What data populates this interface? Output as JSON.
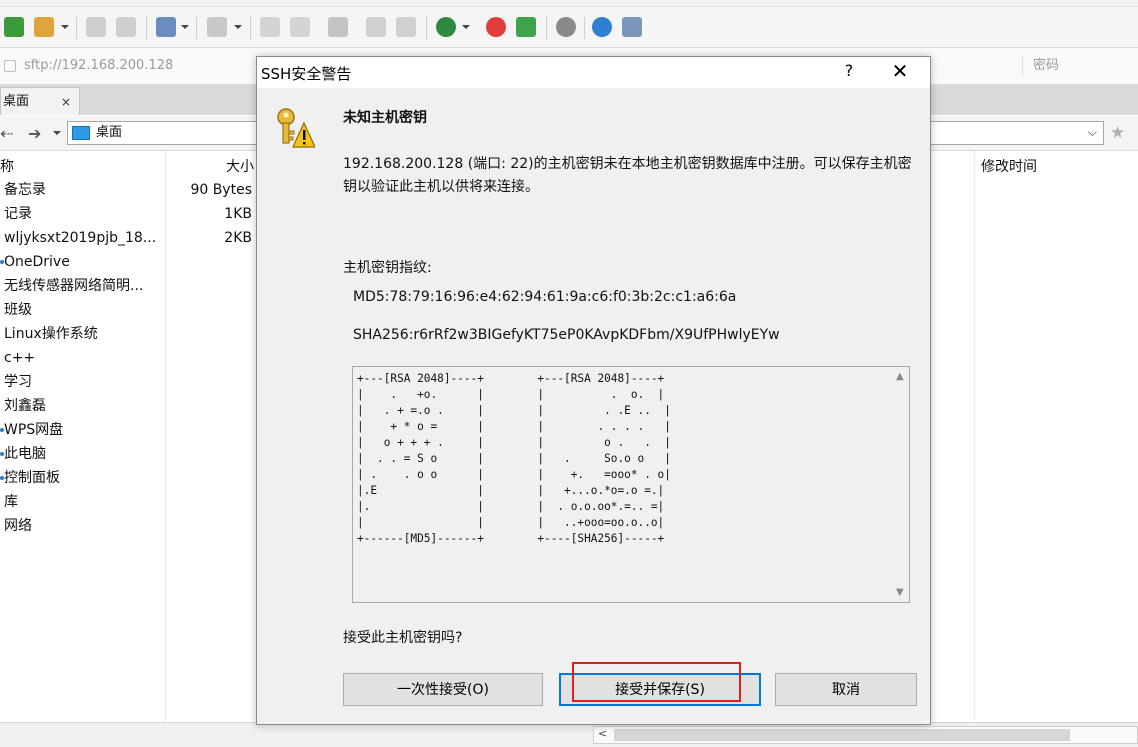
{
  "toolbar": {
    "icons": [
      "new-session-icon",
      "open-folder-icon",
      "connect-icon",
      "disconnect-icon",
      "settings-icon",
      "terminal-icon",
      "copy-icon",
      "paste-icon",
      "sync-icon",
      "queue-icon",
      "web-icon",
      "snail-icon",
      "edit-icon",
      "gear-icon",
      "help-icon",
      "chat-icon"
    ]
  },
  "address": {
    "host": "sftp://192.168.200.128",
    "password_placeholder": "密码"
  },
  "tab": {
    "label": "桌面",
    "close": "×"
  },
  "nav": {
    "path": "桌面"
  },
  "columns": {
    "name": "称",
    "size": "大小",
    "modified": "修改时间"
  },
  "files": [
    {
      "name": "备忘录",
      "size": "90 Bytes"
    },
    {
      "name": "记录",
      "size": "1KB"
    },
    {
      "name": "wljyksxt2019pjb_18...",
      "size": "2KB"
    },
    {
      "name": "OneDrive",
      "size": ""
    },
    {
      "name": "无线传感器网络简明...",
      "size": ""
    },
    {
      "name": "班级",
      "size": ""
    },
    {
      "name": "Linux操作系统",
      "size": ""
    },
    {
      "name": "c++",
      "size": ""
    },
    {
      "name": "学习",
      "size": ""
    },
    {
      "name": "刘鑫磊",
      "size": ""
    },
    {
      "name": "WPS网盘",
      "size": ""
    },
    {
      "name": "此电脑",
      "size": ""
    },
    {
      "name": "控制面板",
      "size": ""
    },
    {
      "name": "库",
      "size": ""
    },
    {
      "name": "网络",
      "size": ""
    }
  ],
  "dialog": {
    "title": "SSH安全警告",
    "help": "?",
    "close": "✕",
    "heading": "未知主机密钥",
    "message": "192.168.200.128 (端口: 22)的主机密钥未在本地主机密钥数据库中注册。可以保存主机密钥以验证此主机以供将来连接。",
    "fingerprint_label": "主机密钥指纹:",
    "md5": "MD5:78:79:16:96:e4:62:94:61:9a:c6:f0:3b:2c:c1:a6:6a",
    "sha256": "SHA256:r6rRf2w3BIGefyKT75eP0KAvpKDFbm/X9UfPHwlyEYw",
    "randomart": "+---[RSA 2048]----+        +---[RSA 2048]----+\n|    .   +o.      |        |          .  o.  |\n|   . + =.o .     |        |         . .E ..  |\n|    + * o =      |        |        . . . .   |\n|   o + + + .     |        |         o .   .  |\n|  . . = S o      |        |   .     So.o o   |\n| .    . o o      |        |    +.   =ooo* . o|\n|.E               |        |   +...o.*o=.o =.|\n|.                |        |  . o.o.oo*.=.. =|\n|                 |        |   ..+ooo=oo.o..o|\n+------[MD5]------+        +----[SHA256]-----+",
    "question": "接受此主机密钥吗?",
    "buttons": {
      "once": "一次性接受(O)",
      "save": "接受并保存(S)",
      "cancel": "取消"
    },
    "highlight_color": "#e02020",
    "default_button_color": "#0078d7"
  }
}
